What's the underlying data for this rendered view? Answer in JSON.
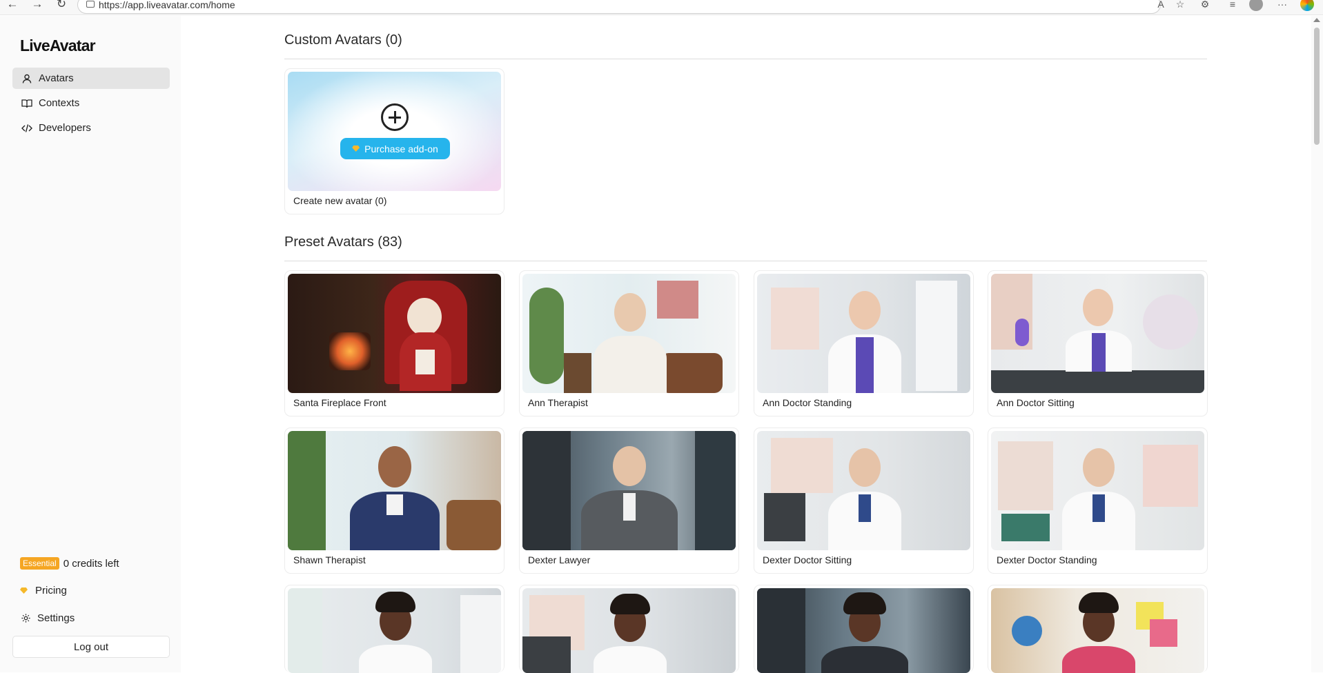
{
  "browser": {
    "url": "https://app.liveavatar.com/home"
  },
  "sidebar": {
    "logo": "LiveAvatar",
    "nav": [
      {
        "label": "Avatars",
        "icon": "user-icon",
        "active": true
      },
      {
        "label": "Contexts",
        "icon": "book-icon",
        "active": false
      },
      {
        "label": "Developers",
        "icon": "code-icon",
        "active": false
      }
    ],
    "plan_badge": "Essential",
    "credits": "0 credits left",
    "pricing": "Pricing",
    "settings": "Settings",
    "logout": "Log out"
  },
  "custom": {
    "title": "Custom Avatars (0)",
    "purchase_label": "Purchase add-on",
    "create_label": "Create new avatar (0)"
  },
  "preset": {
    "title": "Preset Avatars (83)",
    "avatars": [
      "Santa Fireplace Front",
      "Ann Therapist",
      "Ann Doctor Standing",
      "Ann Doctor Sitting",
      "Shawn Therapist",
      "Dexter Lawyer",
      "Dexter Doctor Sitting",
      "Dexter Doctor Standing"
    ]
  },
  "colors": {
    "accent": "#26b4ec",
    "badge": "#f5a623",
    "active_nav": "#e4e4e4"
  }
}
